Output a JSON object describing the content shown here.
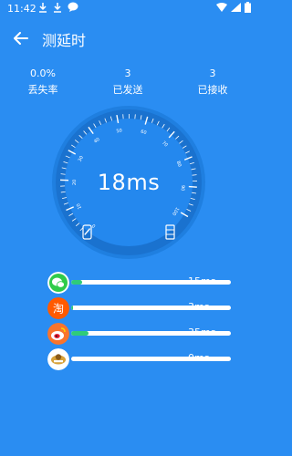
{
  "status_bar": {
    "time": "11:42"
  },
  "header": {
    "title": "测延时"
  },
  "stats": [
    {
      "value": "0.0%",
      "label": "丢失率"
    },
    {
      "value": "3",
      "label": "已发送"
    },
    {
      "value": "3",
      "label": "已接收"
    }
  ],
  "gauge": {
    "latency": "18ms",
    "tick_labels": [
      "0",
      "10",
      "20",
      "30",
      "40",
      "50",
      "60",
      "70",
      "80",
      "90",
      "100"
    ]
  },
  "apps": [
    {
      "name": "wechat-icon",
      "latency": "15ms",
      "fraction": 0.07,
      "color": "#2FCB7A"
    },
    {
      "name": "taobao-icon",
      "latency": "3ms",
      "fraction": 0.01,
      "color": "#FF5A00"
    },
    {
      "name": "weibo-icon",
      "latency": "35ms",
      "fraction": 0.11,
      "color": "#F8742C"
    },
    {
      "name": "game-icon",
      "latency": "0ms",
      "fraction": 0.0,
      "color": "#D8A23A"
    }
  ]
}
